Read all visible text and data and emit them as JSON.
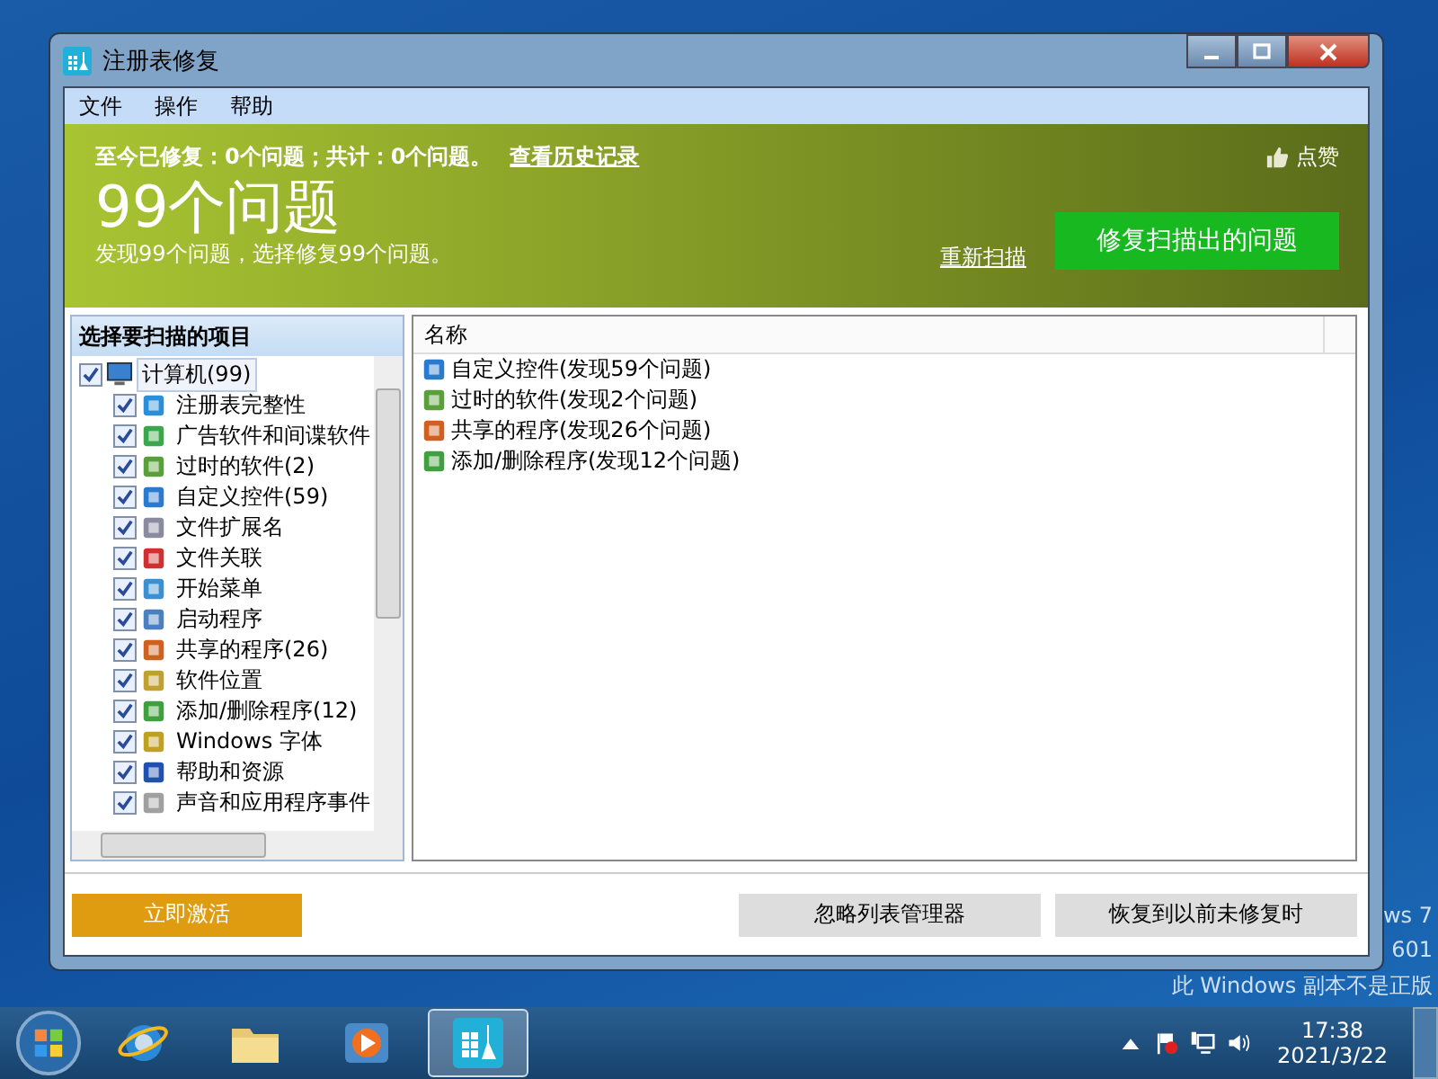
{
  "desktop": {
    "watermark_lines": [
      "ws 7",
      "601",
      "此 Windows 副本不是正版"
    ]
  },
  "window": {
    "title": "注册表修复"
  },
  "menu": [
    "文件",
    "操作",
    "帮助"
  ],
  "banner": {
    "stats": "至今已修复：0个问题；共计：0个问题。",
    "history_link": "查看历史记录",
    "like": "点赞",
    "headline": "99个问题",
    "summary": "发现99个问题，选择修复99个问题。",
    "rescan_link": "重新扫描",
    "fix_button": "修复扫描出的问题"
  },
  "scan_panel": {
    "title": "选择要扫描的项目",
    "tree": [
      {
        "label": "计算机(99)",
        "checked": true,
        "selected": true,
        "children": [
          {
            "label": "注册表完整性",
            "checked": true,
            "selected": false
          },
          {
            "label": "广告软件和间谍软件",
            "checked": true,
            "selected": false
          },
          {
            "label": "过时的软件(2)",
            "checked": true,
            "selected": false
          },
          {
            "label": "自定义控件(59)",
            "checked": true,
            "selected": false
          },
          {
            "label": "文件扩展名",
            "checked": true,
            "selected": false
          },
          {
            "label": "文件关联",
            "checked": true,
            "selected": false
          },
          {
            "label": "开始菜单",
            "checked": true,
            "selected": false
          },
          {
            "label": "启动程序",
            "checked": true,
            "selected": false
          },
          {
            "label": "共享的程序(26)",
            "checked": true,
            "selected": false
          },
          {
            "label": "软件位置",
            "checked": true,
            "selected": false
          },
          {
            "label": "添加/删除程序(12)",
            "checked": true,
            "selected": false
          },
          {
            "label": "Windows 字体",
            "checked": true,
            "selected": false
          },
          {
            "label": "帮助和资源",
            "checked": true,
            "selected": false
          },
          {
            "label": "声音和应用程序事件",
            "checked": true,
            "selected": false
          }
        ]
      }
    ]
  },
  "results": {
    "columns": [
      "名称"
    ],
    "rows": [
      {
        "name": "自定义控件(发现59个问题)"
      },
      {
        "name": "过时的软件(发现2个问题)"
      },
      {
        "name": "共享的程序(发现26个问题)"
      },
      {
        "name": "添加/删除程序(发现12个问题)"
      }
    ]
  },
  "footer": {
    "activate_button": "立即激活",
    "buttons": [
      "忽略列表管理器",
      "恢复到以前未修复时"
    ]
  },
  "taskbar": {
    "items": [
      {
        "selected": false
      },
      {
        "selected": false
      },
      {
        "selected": false
      },
      {
        "selected": true
      }
    ],
    "clock_time": "17:38",
    "clock_date": "2021/3/22"
  }
}
